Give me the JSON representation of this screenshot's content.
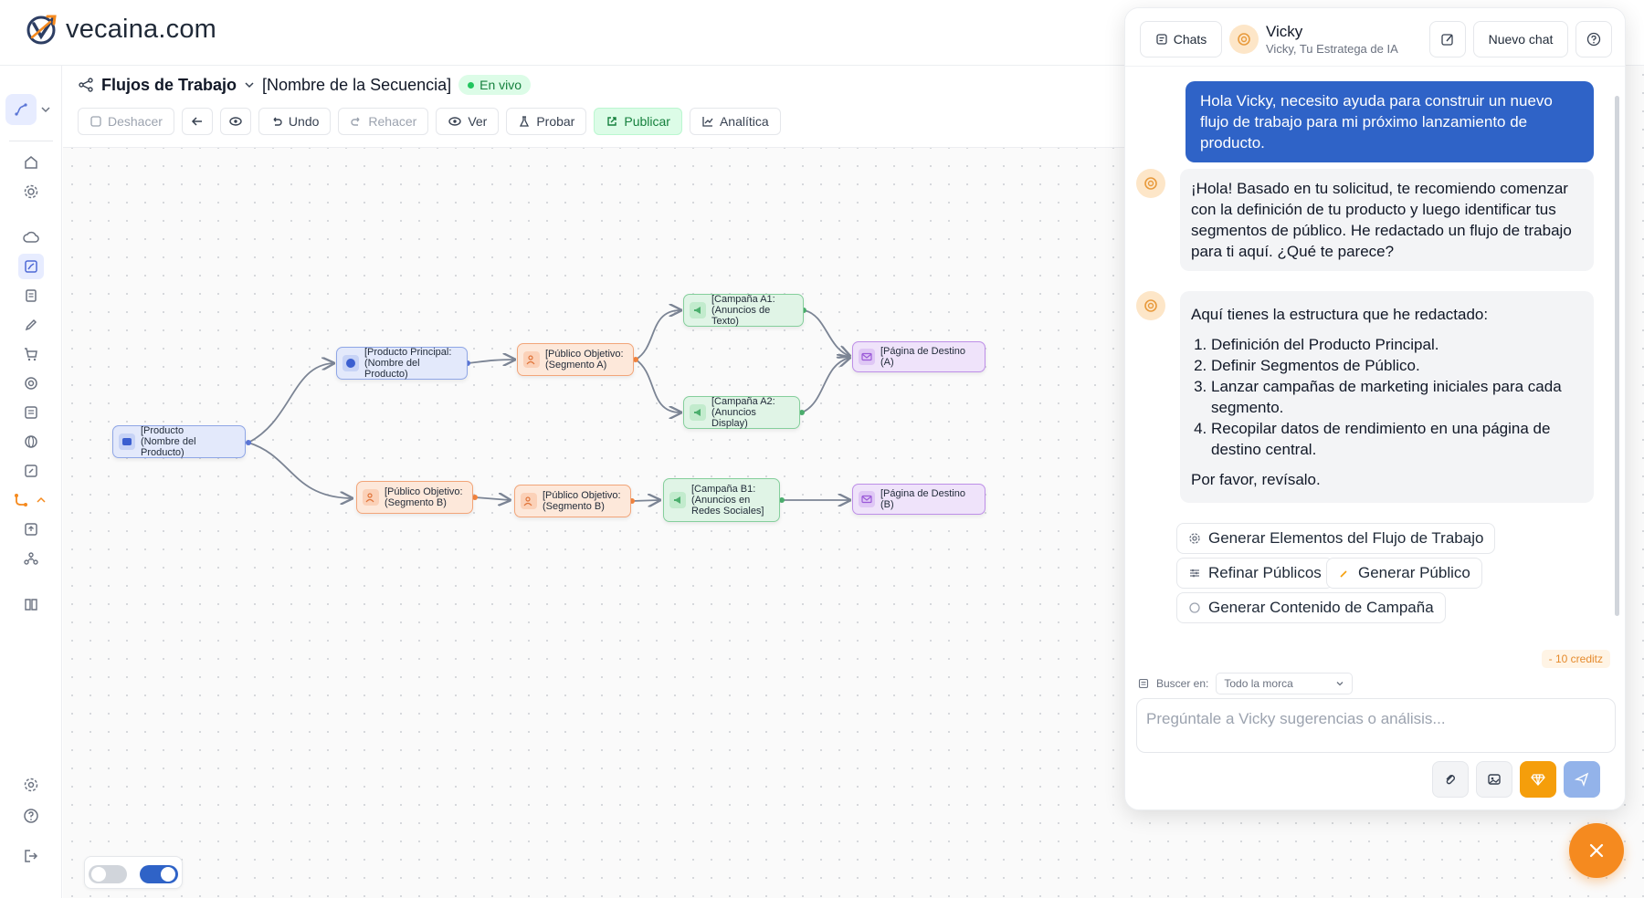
{
  "brand": {
    "logo_text": "vecaina.com"
  },
  "workflow": {
    "title": "Flujos de Trabajo",
    "sequence_name": "[Nombre de la Secuencia]",
    "status": "En vivo"
  },
  "toolbar": {
    "deshacer": "Deshacer",
    "undo": "Undo",
    "rehacer": "Rehacer",
    "ver": "Ver",
    "probar": "Probar",
    "publicar": "Publicar",
    "analitica": "Analítica"
  },
  "nodes": {
    "producto": "[Producto\n(Nombre del Producto)",
    "producto_principal": "[Producto Principal:\n(Nombre del Producto)",
    "publico_a": "[Público Objetivo:\n(Segmento A)",
    "campana_a1": "[Campaña A1:\n(Anuncios de Texto)",
    "campana_a2": "[Campaña A2:\n(Anuncios Display)",
    "destino_a": "[Página de Destino (A)",
    "publico_b1": "[Público Objetivo:\n(Segmento B)",
    "publico_b2": "[Público Objetivo:\n(Segmento B)",
    "campana_b1": "[Campaña B1:\n(Anuncios en\nRedes Sociales]",
    "destino_b": "[Página de Destino (B)"
  },
  "chat": {
    "chats_label": "Chats",
    "assistant_name": "Vicky",
    "assistant_role": "Vicky, Tu Estratega de IA",
    "new_chat_label": "Nuevo chat",
    "user_message": "Hola Vicky, necesito ayuda para construir un nuevo flujo de trabajo para mi próximo lanzamiento de producto.",
    "bot_message_1": "¡Hola! Basado en tu solicitud, te recomiendo comenzar con la definición de tu producto y luego identificar tus segmentos de público. He redactado un flujo de trabajo para ti aquí. ¿Qué te parece?",
    "bot_message_2_intro": "Aquí tienes la estructura que he redactado:",
    "bot_message_2_items": [
      "Definición del Producto Principal.",
      "Definir Segmentos de Público.",
      "Lanzar campañas de marketing iniciales para cada segmento.",
      "Recopilar datos de rendimiento en una página de destino central."
    ],
    "bot_message_2_outro": "Por favor, revísalo.",
    "suggestions": [
      "Generar Elementos del Flujo de Trabajo",
      "Refinar Públicos",
      "Generar Público",
      "Generar Contenido de Campaña"
    ],
    "credits": "- 10 creditz",
    "search_in_label": "Buscer en:",
    "search_in_value": "Todo la morca",
    "input_placeholder": "Pregúntale a Vicky sugerencias o análisis..."
  },
  "colors": {
    "accent_blue": "#2f63c7",
    "accent_orange": "#f58a1f",
    "live_green": "#22c55e"
  }
}
